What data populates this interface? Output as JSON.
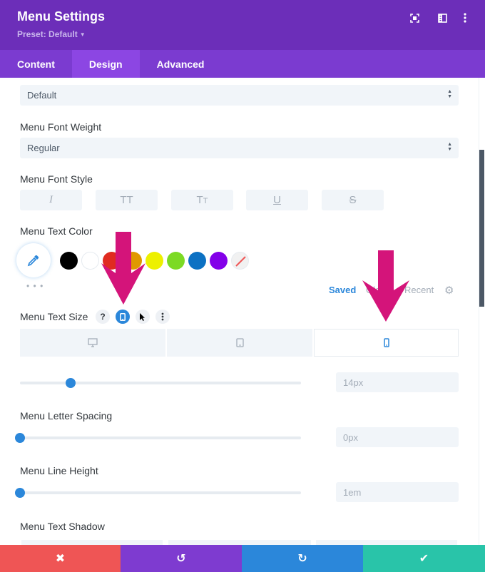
{
  "header": {
    "title": "Menu Settings",
    "preset_label": "Preset: Default",
    "icons": [
      "fullscreen-icon",
      "split-view-icon",
      "more-options-icon"
    ]
  },
  "tabs": [
    {
      "label": "Content",
      "active": false
    },
    {
      "label": "Design",
      "active": true
    },
    {
      "label": "Advanced",
      "active": false
    }
  ],
  "fields": {
    "font_select": {
      "value": "Default"
    },
    "font_weight": {
      "label": "Menu Font Weight",
      "value": "Regular"
    },
    "font_style": {
      "label": "Menu Font Style",
      "buttons": [
        {
          "name": "italic",
          "glyph": "I"
        },
        {
          "name": "uppercase",
          "glyph": "TT"
        },
        {
          "name": "capitalize",
          "glyph": "Tт"
        },
        {
          "name": "underline",
          "glyph": "U"
        },
        {
          "name": "strikethrough",
          "glyph": "S"
        }
      ]
    },
    "text_color": {
      "label": "Menu Text Color",
      "swatches": [
        "#000000",
        "#ffffff",
        "#e02b20",
        "#e09900",
        "#edf000",
        "#7cda24",
        "#0c71c3",
        "#8300e9",
        "none"
      ],
      "more_label": "• • •",
      "palette_tabs": [
        {
          "label": "Saved",
          "active": true
        },
        {
          "label": "Global",
          "active": false
        },
        {
          "label": "Recent",
          "active": false
        }
      ]
    },
    "text_size": {
      "label": "Menu Text Size",
      "option_icons": [
        "help-icon",
        "responsive-phone-icon",
        "hover-cursor-icon",
        "more-options-icon"
      ],
      "devices": [
        {
          "name": "desktop",
          "active": false
        },
        {
          "name": "tablet",
          "active": false
        },
        {
          "name": "phone",
          "active": true
        }
      ],
      "value": "14px",
      "slider_fraction": 0.18
    },
    "letter_spacing": {
      "label": "Menu Letter Spacing",
      "value": "0px",
      "slider_fraction": 0.0
    },
    "line_height": {
      "label": "Menu Line Height",
      "value": "1em",
      "slider_fraction": 0.0
    },
    "text_shadow": {
      "label": "Menu Text Shadow"
    }
  },
  "footer": {
    "buttons": [
      {
        "name": "discard",
        "glyph": "✖",
        "color": "#ef5555"
      },
      {
        "name": "undo",
        "glyph": "↺",
        "color": "#7e3bd0"
      },
      {
        "name": "redo",
        "glyph": "↻",
        "color": "#2b87da"
      },
      {
        "name": "save",
        "glyph": "✔",
        "color": "#29c4a9"
      }
    ]
  },
  "colors": {
    "header": "#6c2eb9",
    "tab_bar": "#7b3bd0",
    "tab_active": "#8c46e3",
    "accent": "#2b87da",
    "annotation_arrow": "#d4147a"
  }
}
